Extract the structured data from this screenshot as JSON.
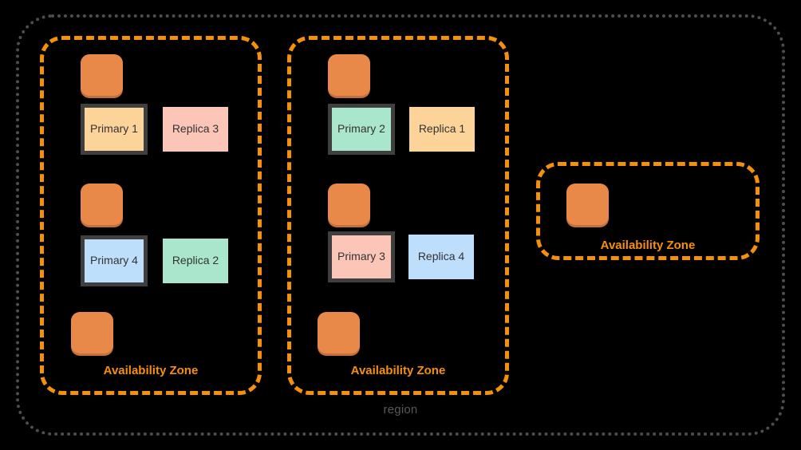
{
  "diagram": {
    "title": "region",
    "region": {
      "label": "region",
      "label_color": "#595959",
      "border_color": "#4d4d4d",
      "border_style": "dotted"
    },
    "colors": {
      "background": "#000000",
      "az_border": "#F79009",
      "az_label": "#F79009",
      "service_icon": "#E8894A",
      "service_icon_shadow": "#c4703a",
      "node_border": "#3f3f3f",
      "node_text": "#333333",
      "fill_peach": "#FCD49A",
      "fill_pink": "#FBC5B8",
      "fill_mint": "#A9E6CC",
      "fill_blue": "#BEDFFC"
    },
    "availability_zones": [
      {
        "id": "az-1",
        "label": "Availability Zone",
        "service_icons": [
          {
            "name": "service-icon-1"
          },
          {
            "name": "service-icon-2"
          },
          {
            "name": "service-icon-3"
          }
        ],
        "nodes": [
          {
            "label": "Primary 1",
            "role": "primary",
            "fill": "#FCD49A"
          },
          {
            "label": "Replica 3",
            "role": "replica",
            "fill": "#FBC5B8"
          },
          {
            "label": "Primary 4",
            "role": "primary",
            "fill": "#BEDFFC"
          },
          {
            "label": "Replica 2",
            "role": "replica",
            "fill": "#A9E6CC"
          }
        ]
      },
      {
        "id": "az-2",
        "label": "Availability Zone",
        "service_icons": [
          {
            "name": "service-icon-1"
          },
          {
            "name": "service-icon-2"
          },
          {
            "name": "service-icon-3"
          }
        ],
        "nodes": [
          {
            "label": "Primary 2",
            "role": "primary",
            "fill": "#A9E6CC"
          },
          {
            "label": "Replica 1",
            "role": "replica",
            "fill": "#FCD49A"
          },
          {
            "label": "Primary 3",
            "role": "primary",
            "fill": "#FBC5B8"
          },
          {
            "label": "Replica 4",
            "role": "replica",
            "fill": "#BEDFFC"
          }
        ]
      },
      {
        "id": "az-3",
        "label": "Availability Zone",
        "service_icons": [
          {
            "name": "service-icon-1"
          }
        ],
        "nodes": []
      }
    ]
  }
}
